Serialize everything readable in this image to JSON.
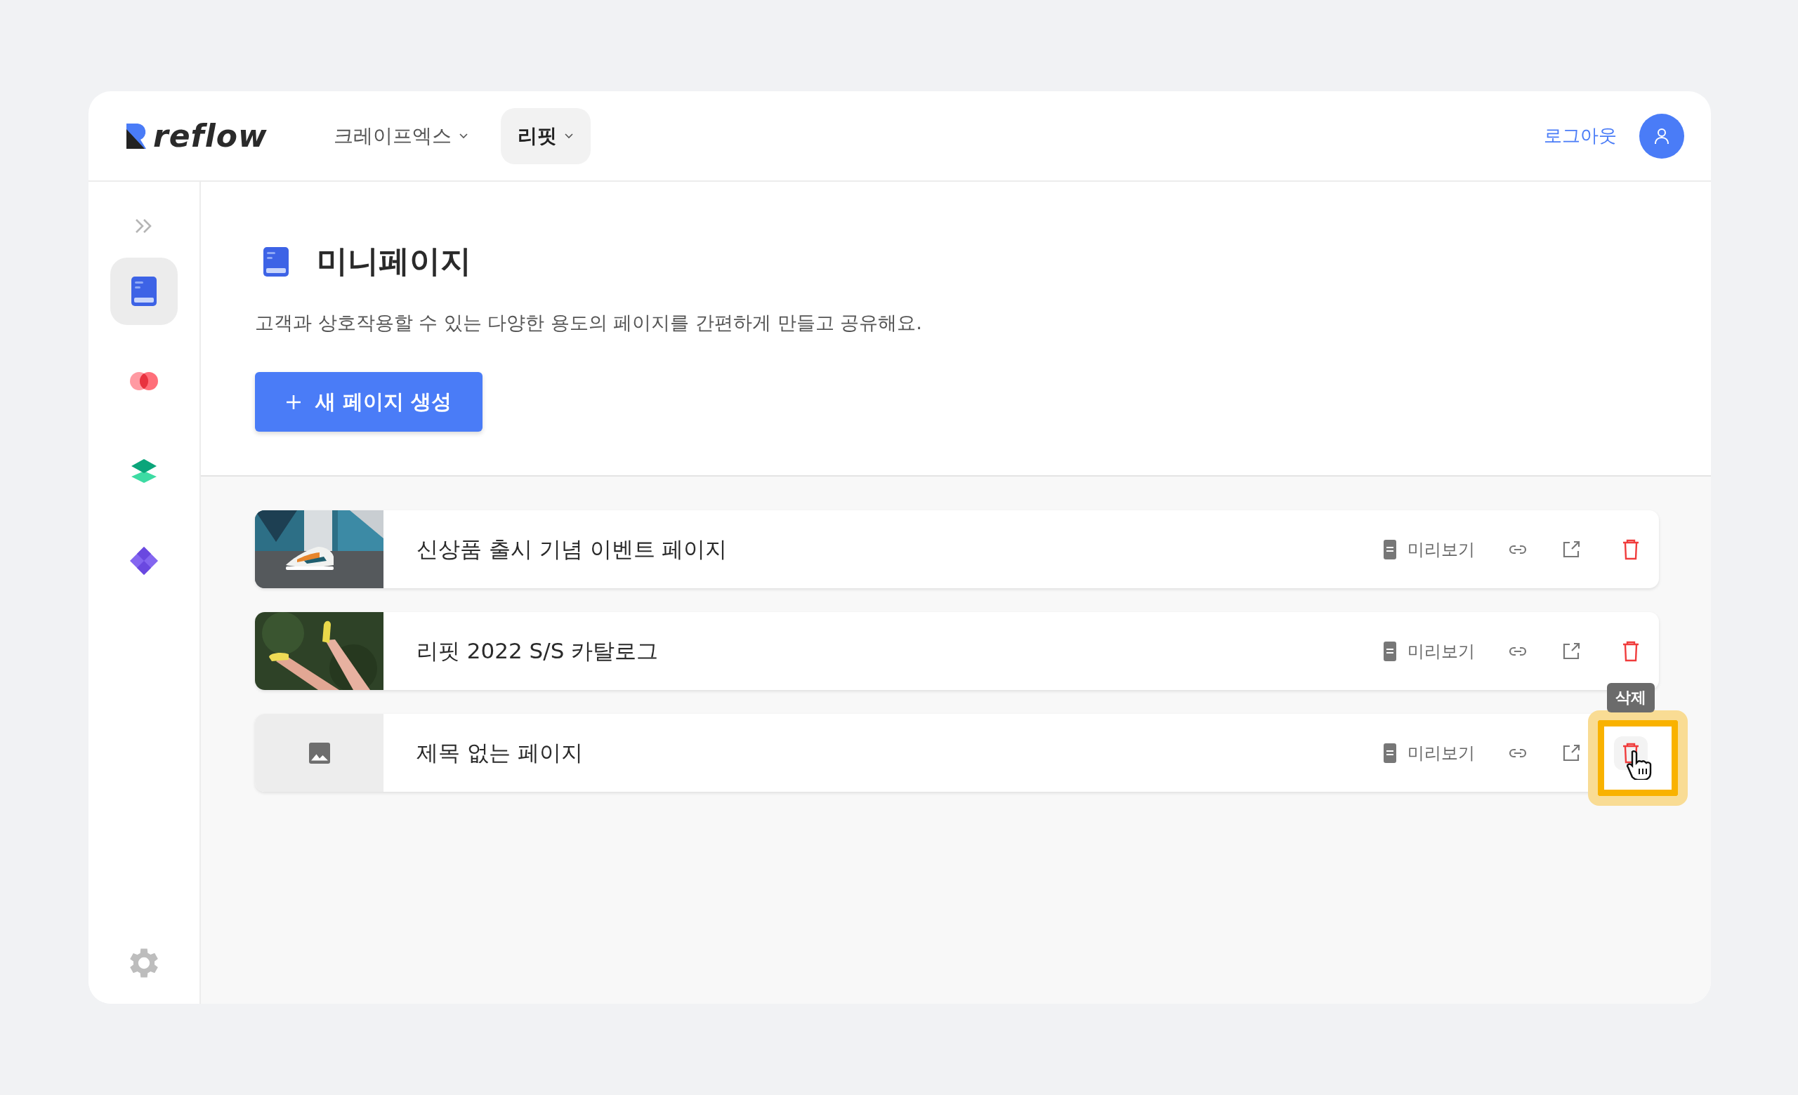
{
  "header": {
    "logo": "reflow",
    "nav": [
      {
        "label": "크레이프엑스",
        "selected": false
      },
      {
        "label": "리핏",
        "selected": true
      }
    ],
    "logout": "로그아웃"
  },
  "sidebar": {
    "items": [
      {
        "kind": "pages",
        "selected": true
      },
      {
        "kind": "circles",
        "selected": false
      },
      {
        "kind": "layers",
        "selected": false
      },
      {
        "kind": "puzzle",
        "selected": false
      }
    ]
  },
  "page": {
    "title": "미니페이지",
    "description": "고객과 상호작용할 수 있는 다양한 용도의 페이지를 간편하게 만들고 공유해요.",
    "create_button": "새 페이지 생성"
  },
  "pages": [
    {
      "title": "신상품 출시 기념 이벤트 페이지",
      "preview": "미리보기",
      "delete_hovered": false
    },
    {
      "title": "리핏 2022 S/S 카탈로그",
      "preview": "미리보기",
      "delete_hovered": false
    },
    {
      "title": "제목 없는 페이지",
      "thumbnail": {
        "kind": "placeholder"
      },
      "preview": "미리보기",
      "delete_hovered": true,
      "delete_tooltip": "삭제"
    }
  ]
}
